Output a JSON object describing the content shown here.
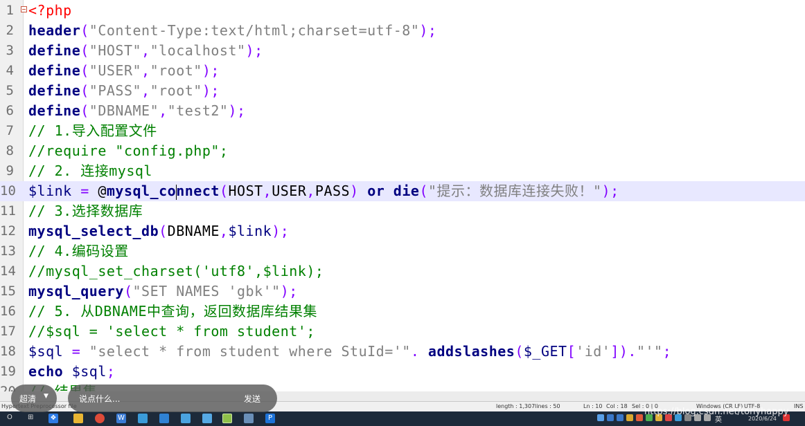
{
  "editor": {
    "lines": [
      {
        "n": "1",
        "tokens": [
          {
            "t": "<?php",
            "c": "phptag"
          }
        ]
      },
      {
        "n": "2",
        "tokens": [
          {
            "t": "header",
            "c": "kw"
          },
          {
            "t": "(",
            "c": "op"
          },
          {
            "t": "\"Content-Type:text/html;charset=utf-8\"",
            "c": "str"
          },
          {
            "t": ");",
            "c": "op"
          }
        ]
      },
      {
        "n": "3",
        "tokens": [
          {
            "t": "define",
            "c": "kw"
          },
          {
            "t": "(",
            "c": "op"
          },
          {
            "t": "\"HOST\"",
            "c": "str"
          },
          {
            "t": ",",
            "c": "op"
          },
          {
            "t": "\"localhost\"",
            "c": "str"
          },
          {
            "t": ");",
            "c": "op"
          }
        ]
      },
      {
        "n": "4",
        "tokens": [
          {
            "t": "define",
            "c": "kw"
          },
          {
            "t": "(",
            "c": "op"
          },
          {
            "t": "\"USER\"",
            "c": "str"
          },
          {
            "t": ",",
            "c": "op"
          },
          {
            "t": "\"root\"",
            "c": "str"
          },
          {
            "t": ");",
            "c": "op"
          }
        ]
      },
      {
        "n": "5",
        "tokens": [
          {
            "t": "define",
            "c": "kw"
          },
          {
            "t": "(",
            "c": "op"
          },
          {
            "t": "\"PASS\"",
            "c": "str"
          },
          {
            "t": ",",
            "c": "op"
          },
          {
            "t": "\"root\"",
            "c": "str"
          },
          {
            "t": ");",
            "c": "op"
          }
        ]
      },
      {
        "n": "6",
        "tokens": [
          {
            "t": "define",
            "c": "kw"
          },
          {
            "t": "(",
            "c": "op"
          },
          {
            "t": "\"DBNAME\"",
            "c": "str"
          },
          {
            "t": ",",
            "c": "op"
          },
          {
            "t": "\"test2\"",
            "c": "str"
          },
          {
            "t": ");",
            "c": "op"
          }
        ]
      },
      {
        "n": "7",
        "tokens": [
          {
            "t": "// 1.导入配置文件",
            "c": "cm"
          }
        ]
      },
      {
        "n": "8",
        "tokens": [
          {
            "t": "//require \"config.php\";",
            "c": "cm"
          }
        ]
      },
      {
        "n": "9",
        "tokens": [
          {
            "t": "// 2. 连接mysql",
            "c": "cm"
          }
        ]
      },
      {
        "n": "10",
        "current": true,
        "tokens": [
          {
            "t": "$link",
            "c": "var"
          },
          {
            "t": " = ",
            "c": "op"
          },
          {
            "t": "@",
            "c": "txt"
          },
          {
            "t": "mysql_co",
            "c": "kw"
          },
          {
            "t": "",
            "c": "caret"
          },
          {
            "t": "nnect",
            "c": "kw"
          },
          {
            "t": "(",
            "c": "op"
          },
          {
            "t": "HOST",
            "c": "txt"
          },
          {
            "t": ",",
            "c": "op"
          },
          {
            "t": "USER",
            "c": "txt"
          },
          {
            "t": ",",
            "c": "op"
          },
          {
            "t": "PASS",
            "c": "txt"
          },
          {
            "t": ") ",
            "c": "op"
          },
          {
            "t": "or die",
            "c": "kw"
          },
          {
            "t": "(",
            "c": "op"
          },
          {
            "t": "\"提示：数据库连接失败！\"",
            "c": "str"
          },
          {
            "t": ");",
            "c": "op"
          }
        ]
      },
      {
        "n": "11",
        "tokens": [
          {
            "t": "// 3.选择数据库",
            "c": "cm"
          }
        ]
      },
      {
        "n": "12",
        "tokens": [
          {
            "t": "mysql_select_db",
            "c": "kw"
          },
          {
            "t": "(",
            "c": "op"
          },
          {
            "t": "DBNAME",
            "c": "txt"
          },
          {
            "t": ",",
            "c": "op"
          },
          {
            "t": "$link",
            "c": "var"
          },
          {
            "t": ");",
            "c": "op"
          }
        ]
      },
      {
        "n": "13",
        "tokens": [
          {
            "t": "// 4.编码设置",
            "c": "cm"
          }
        ]
      },
      {
        "n": "14",
        "tokens": [
          {
            "t": "//mysql_set_charset('utf8',$link);",
            "c": "cm"
          }
        ]
      },
      {
        "n": "15",
        "tokens": [
          {
            "t": "mysql_query",
            "c": "kw"
          },
          {
            "t": "(",
            "c": "op"
          },
          {
            "t": "\"SET NAMES 'gbk'\"",
            "c": "str"
          },
          {
            "t": ");",
            "c": "op"
          }
        ]
      },
      {
        "n": "16",
        "tokens": [
          {
            "t": "// 5. 从DBNAME中查询，返回数据库结果集",
            "c": "cm"
          }
        ]
      },
      {
        "n": "17",
        "tokens": [
          {
            "t": "//$sql = 'select * from student';",
            "c": "cm"
          }
        ]
      },
      {
        "n": "18",
        "tokens": [
          {
            "t": "$sql",
            "c": "var"
          },
          {
            "t": " = ",
            "c": "op"
          },
          {
            "t": "\"select * from student where StuId='\"",
            "c": "str"
          },
          {
            "t": ". ",
            "c": "op"
          },
          {
            "t": "addslashes",
            "c": "kw"
          },
          {
            "t": "(",
            "c": "op"
          },
          {
            "t": "$_GET",
            "c": "var"
          },
          {
            "t": "[",
            "c": "op"
          },
          {
            "t": "'id'",
            "c": "str"
          },
          {
            "t": "]).",
            "c": "op"
          },
          {
            "t": "\"'\"",
            "c": "str"
          },
          {
            "t": ";",
            "c": "op"
          }
        ]
      },
      {
        "n": "19",
        "tokens": [
          {
            "t": "echo",
            "c": "kw"
          },
          {
            "t": " ",
            "c": "txt"
          },
          {
            "t": "$sql",
            "c": "var"
          },
          {
            "t": ";",
            "c": "op"
          }
        ]
      },
      {
        "n": "20",
        "tokens": [
          {
            "t": "// 结果集",
            "c": "cm"
          }
        ]
      }
    ]
  },
  "statusbar": {
    "file_type": "Hypertext Preprocessor file",
    "length": "length : 1,307",
    "lines": "lines : 50",
    "ln": "Ln : 10",
    "col": "Col : 18",
    "sel": "Sel : 0 | 0",
    "eol": "Windows (CR LF)",
    "encoding": "UTF-8",
    "ins": "INS"
  },
  "overlay": {
    "quality_label": "超清",
    "comment_placeholder": "说点什么...",
    "send_label": "发送",
    "watermark": "https://blog.csdn.net/tonyhappy"
  },
  "taskbar": {
    "search_label": "O",
    "taskview_label": "⊞",
    "date": "2020/6/24",
    "ime": "英"
  }
}
